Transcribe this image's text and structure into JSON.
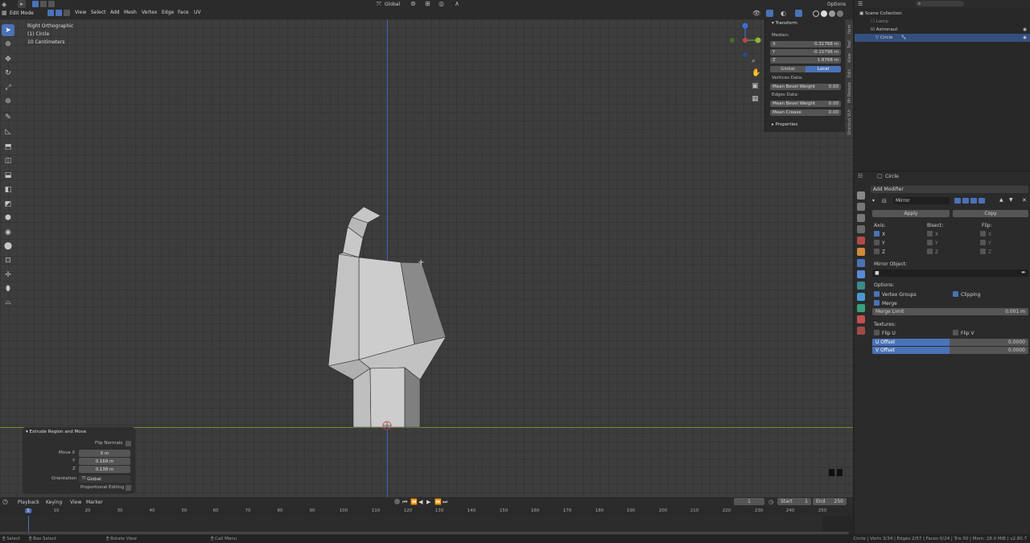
{
  "header": {
    "mode": "Edit Mode",
    "menus": [
      "View",
      "Select",
      "Add",
      "Mesh",
      "Vertex",
      "Edge",
      "Face",
      "UV"
    ],
    "orientation": "Global",
    "options": "Options"
  },
  "viewport": {
    "view_name": "Right Orthographic",
    "object_label": "(1) Circle",
    "scale": "10 Centimeters"
  },
  "npanel": {
    "section_transform": "Transform",
    "median": "Median:",
    "x_label": "X",
    "x_value": "0.31768 m",
    "y_label": "Y",
    "y_value": "-0.15796 m",
    "z_label": "Z",
    "z_value": "1.8768 m",
    "global": "Global",
    "local": "Local",
    "vertices_data": "Vertices Data:",
    "mean_bevel_weight_v": "Mean Bevel Weight",
    "mean_bevel_weight_v_value": "0.00",
    "edges_data": "Edges Data:",
    "mean_bevel_weight_e": "Mean Bevel Weight",
    "mean_bevel_weight_e_value": "0.00",
    "mean_crease": "Mean Crease",
    "mean_crease_value": "0.00",
    "section_properties": "Properties",
    "side_tabs": [
      "Item",
      "Tool",
      "View",
      "Edit",
      "Mr Retopo",
      "Shortcut VUr"
    ]
  },
  "operator": {
    "title": "Extrude Region and Move",
    "flip_normals": "Flip Normals",
    "move_x_label": "Move X",
    "move_x": "0 m",
    "y_label": "Y",
    "move_y": "0.169 m",
    "z_label": "Z",
    "move_z": "0.138 m",
    "orientation_label": "Orientation",
    "orientation": "Global",
    "proportional": "Proportional Editing"
  },
  "outliner": {
    "root": "Scene Collection",
    "items": [
      "Lamp",
      "Astronaut",
      "Circle"
    ]
  },
  "properties": {
    "object_name": "Circle",
    "add_modifier": "Add Modifier",
    "modifier_name": "Mirror",
    "apply": "Apply",
    "copy": "Copy",
    "axis": "Axis:",
    "bisect": "Bisect:",
    "flip": "Flip:",
    "x": "X",
    "y": "Y",
    "z": "Z",
    "mirror_object": "Mirror Object:",
    "options": "Options:",
    "vertex_groups": "Vertex Groups",
    "clipping": "Clipping",
    "merge": "Merge",
    "merge_limit": "Merge Limit",
    "merge_limit_value": "0.001 m",
    "textures": "Textures:",
    "flip_u": "Flip U",
    "flip_v": "Flip V",
    "u_offset": "U Offset",
    "u_offset_value": "0.0000",
    "v_offset": "V Offset",
    "v_offset_value": "0.0000"
  },
  "timeline": {
    "menus": [
      "Playback",
      "Keying",
      "View",
      "Marker"
    ],
    "current_frame": "1",
    "start_label": "Start",
    "start": "1",
    "end_label": "End",
    "end": "250",
    "ticks": [
      "1",
      "10",
      "20",
      "30",
      "40",
      "50",
      "60",
      "70",
      "80",
      "90",
      "100",
      "110",
      "120",
      "130",
      "140",
      "150",
      "160",
      "170",
      "180",
      "190",
      "200",
      "210",
      "220",
      "230",
      "240",
      "250"
    ]
  },
  "status": {
    "select": "Select",
    "box_select": "Box Select",
    "rotate_view": "Rotate View",
    "call_menu": "Call Menu",
    "stats": "Circle | Verts 3/34 | Edges 2/57 | Faces 0/24 | Tris 50 | Mem: 28.0 MiB | v2.80.7"
  },
  "colors": {
    "accent": "#4a72b8",
    "axis_blue": "#3d6fd6",
    "axis_green": "#7a9a3a",
    "mesh": "#c8c8c8"
  }
}
